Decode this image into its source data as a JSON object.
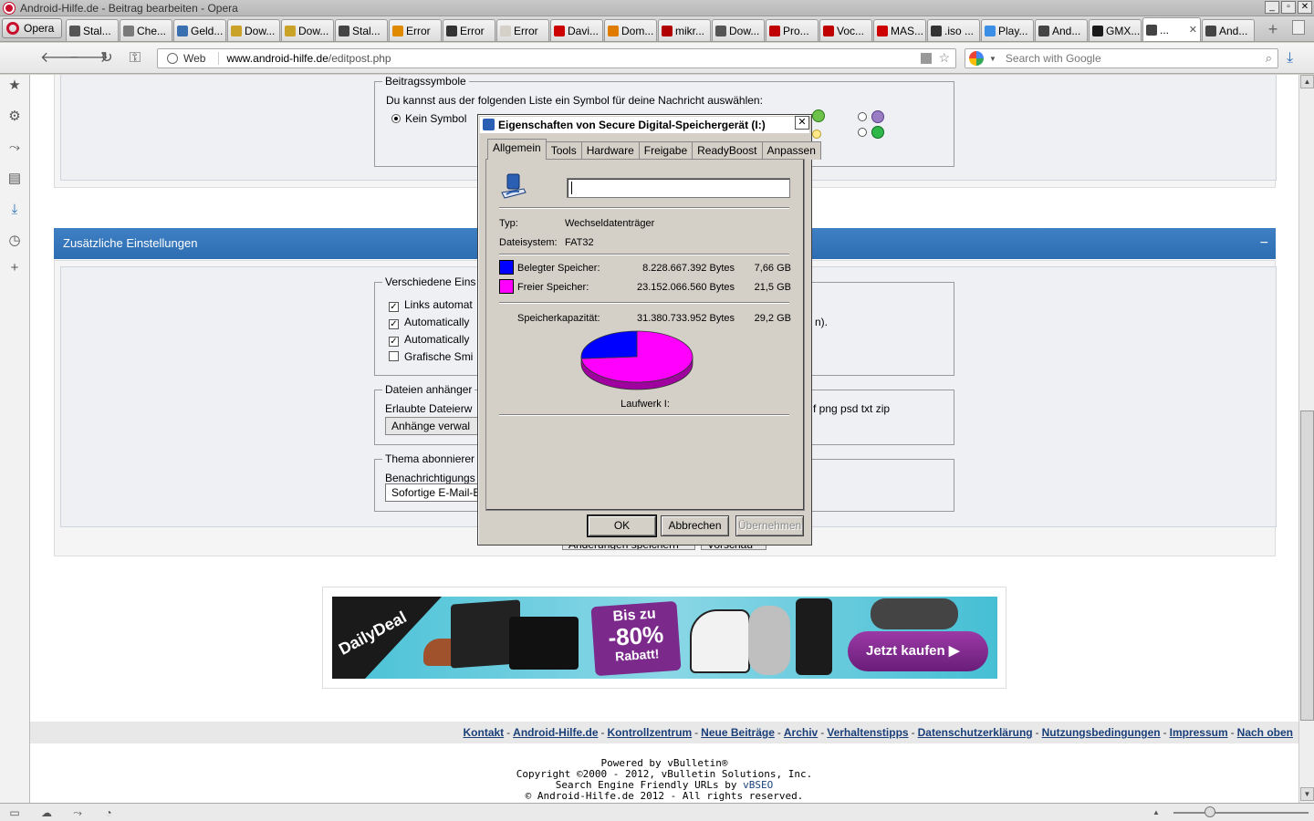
{
  "window": {
    "title": "Android-Hilfe.de - Beitrag bearbeiten - Opera",
    "controls": [
      "_",
      "▫",
      "✕"
    ]
  },
  "tabstrip": {
    "menu_label": "Opera",
    "tabs": [
      {
        "label": "Stal...",
        "color": "#555555"
      },
      {
        "label": "Che...",
        "color": "#7a7a7a"
      },
      {
        "label": "Geld...",
        "color": "#3a6fb0"
      },
      {
        "label": "Dow...",
        "color": "#c9a227"
      },
      {
        "label": "Dow...",
        "color": "#c9a227"
      },
      {
        "label": "Stal...",
        "color": "#444444"
      },
      {
        "label": "Error",
        "color": "#e08a00"
      },
      {
        "label": "Error",
        "color": "#333333"
      },
      {
        "label": "Error",
        "color": "#d4d0c8"
      },
      {
        "label": "Davi...",
        "color": "#cc0000"
      },
      {
        "label": "Dom...",
        "color": "#e07b00"
      },
      {
        "label": "mikr...",
        "color": "#b00000"
      },
      {
        "label": "Dow...",
        "color": "#555555"
      },
      {
        "label": "Pro...",
        "color": "#c00000"
      },
      {
        "label": "Voc...",
        "color": "#c00000"
      },
      {
        "label": "MAS...",
        "color": "#cc0000"
      },
      {
        "label": ".iso ...",
        "color": "#333333"
      },
      {
        "label": "Play...",
        "color": "#3a8ee6"
      },
      {
        "label": "And...",
        "color": "#444444"
      },
      {
        "label": "GMX...",
        "color": "#1a1a1a"
      },
      {
        "label": "...",
        "color": "#444444",
        "active": true
      },
      {
        "label": "And...",
        "color": "#444444"
      }
    ],
    "close_glyph": "✕",
    "new_tab_glyph": "+"
  },
  "toolbar": {
    "back": "🡐",
    "forward": "🡒",
    "reload": "↻",
    "key": "⚿",
    "address_badge": "Web",
    "url_host": "www.android-hilfe.de",
    "url_path": "/editpost.php",
    "search_placeholder": "Search with Google",
    "star_glyph": "☆",
    "search_glyph": "⌕",
    "download_glyph": "⤓"
  },
  "sidebar": {
    "icons": [
      "★",
      "⚙",
      "⤳",
      "▤",
      "⤓",
      "◷",
      "+"
    ]
  },
  "page": {
    "beitragssymbole": {
      "legend": "Beitragssymbole",
      "intro": "Du kannst aus der folgenden Liste ein Symbol für deine Nachricht auswählen:",
      "kein_symbol": "Kein Symbol"
    },
    "section_header": "Zusätzliche Einstellungen",
    "section_collapse": "−",
    "verschiedene": {
      "legend": "Verschiedene Eins",
      "items": [
        {
          "label": "Links automat",
          "checked": true
        },
        {
          "label": "Automatically",
          "checked": true
        },
        {
          "label": "Automatically",
          "checked": true
        },
        {
          "label": "Grafische Smi",
          "checked": false
        }
      ],
      "tail_text": "n)."
    },
    "dateien": {
      "legend": "Dateien anhänger",
      "allowed": "Erlaubte Dateierw",
      "allowed_tail": "f png psd txt zip",
      "button": "Anhänge verwal"
    },
    "thema": {
      "legend": "Thema abonnierer",
      "label": "Benachrichtigungs",
      "select_value": "Sofortige E-Mail-B"
    },
    "hidden_buttons": [
      "Änderungen speichern",
      "Vorschau"
    ]
  },
  "ad": {
    "logo": "DailyDeal",
    "badge_top": "Bis zu",
    "badge_mid": "-80%",
    "badge_bottom": "Rabatt!",
    "cta": "Jetzt kaufen ▶"
  },
  "footer": {
    "links": [
      "Kontakt",
      "Android-Hilfe.de",
      "Kontrollzentrum",
      "Neue Beiträge",
      "Archiv",
      "Verhaltenstipps",
      "Datenschutzerklärung",
      "Nutzungsbedingungen",
      "Impressum",
      "Nach oben"
    ],
    "separator": "-",
    "credits": {
      "powered": "Powered by vBulletin®",
      "copyright": "Copyright ©2000 - 2012, vBulletin Solutions, Inc.",
      "seo_prefix": "Search Engine Friendly URLs by ",
      "seo_link": "vBSEO",
      "rights": "© Android-Hilfe.de 2012 - All rights reserved."
    }
  },
  "dialog": {
    "title": "Eigenschaften von Secure Digital-Speichergerät (I:)",
    "close_glyph": "✕",
    "tabs": [
      "Allgemein",
      "Tools",
      "Hardware",
      "Freigabe",
      "ReadyBoost",
      "Anpassen"
    ],
    "selected_tab": "Allgemein",
    "name_value": "",
    "type_label": "Typ:",
    "type_value": "Wechseldatenträger",
    "fs_label": "Dateisystem:",
    "fs_value": "FAT32",
    "used": {
      "label": "Belegter Speicher:",
      "bytes": "8.228.667.392 Bytes",
      "gb": "7,66 GB",
      "color": "#0000ff"
    },
    "free": {
      "label": "Freier Speicher:",
      "bytes": "23.152.066.560 Bytes",
      "gb": "21,5 GB",
      "color": "#ff00ff"
    },
    "capacity": {
      "label": "Speicherkapazität:",
      "bytes": "31.380.733.952 Bytes",
      "gb": "29,2 GB"
    },
    "drive_label": "Laufwerk I:",
    "used_fraction": 0.262,
    "buttons": {
      "ok": "OK",
      "cancel": "Abbrechen",
      "apply": "Übernehmen"
    }
  },
  "statusbar": {
    "icons": [
      "▭",
      "☁",
      "⤳",
      "◔"
    ],
    "zoom_up": "▲"
  }
}
